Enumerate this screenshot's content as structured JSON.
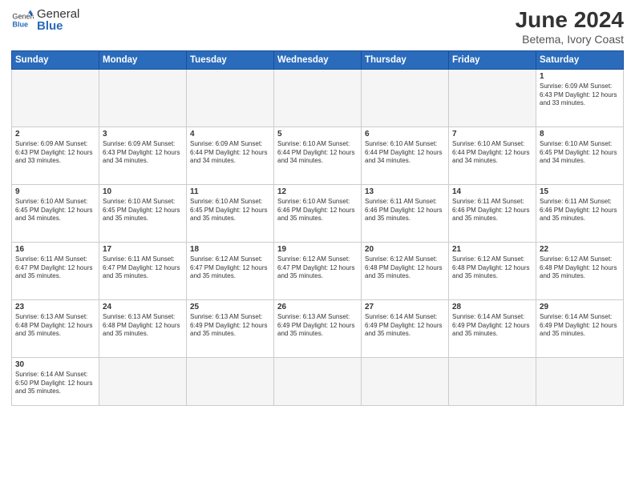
{
  "header": {
    "logo_general": "General",
    "logo_blue": "Blue",
    "title": "June 2024",
    "subtitle": "Betema, Ivory Coast"
  },
  "weekdays": [
    "Sunday",
    "Monday",
    "Tuesday",
    "Wednesday",
    "Thursday",
    "Friday",
    "Saturday"
  ],
  "weeks": [
    [
      {
        "day": "",
        "info": ""
      },
      {
        "day": "",
        "info": ""
      },
      {
        "day": "",
        "info": ""
      },
      {
        "day": "",
        "info": ""
      },
      {
        "day": "",
        "info": ""
      },
      {
        "day": "",
        "info": ""
      },
      {
        "day": "1",
        "info": "Sunrise: 6:09 AM\nSunset: 6:43 PM\nDaylight: 12 hours and 33 minutes."
      }
    ],
    [
      {
        "day": "2",
        "info": "Sunrise: 6:09 AM\nSunset: 6:43 PM\nDaylight: 12 hours and 33 minutes."
      },
      {
        "day": "3",
        "info": "Sunrise: 6:09 AM\nSunset: 6:43 PM\nDaylight: 12 hours and 34 minutes."
      },
      {
        "day": "4",
        "info": "Sunrise: 6:09 AM\nSunset: 6:44 PM\nDaylight: 12 hours and 34 minutes."
      },
      {
        "day": "5",
        "info": "Sunrise: 6:10 AM\nSunset: 6:44 PM\nDaylight: 12 hours and 34 minutes."
      },
      {
        "day": "6",
        "info": "Sunrise: 6:10 AM\nSunset: 6:44 PM\nDaylight: 12 hours and 34 minutes."
      },
      {
        "day": "7",
        "info": "Sunrise: 6:10 AM\nSunset: 6:44 PM\nDaylight: 12 hours and 34 minutes."
      },
      {
        "day": "8",
        "info": "Sunrise: 6:10 AM\nSunset: 6:45 PM\nDaylight: 12 hours and 34 minutes."
      }
    ],
    [
      {
        "day": "9",
        "info": "Sunrise: 6:10 AM\nSunset: 6:45 PM\nDaylight: 12 hours and 34 minutes."
      },
      {
        "day": "10",
        "info": "Sunrise: 6:10 AM\nSunset: 6:45 PM\nDaylight: 12 hours and 35 minutes."
      },
      {
        "day": "11",
        "info": "Sunrise: 6:10 AM\nSunset: 6:45 PM\nDaylight: 12 hours and 35 minutes."
      },
      {
        "day": "12",
        "info": "Sunrise: 6:10 AM\nSunset: 6:46 PM\nDaylight: 12 hours and 35 minutes."
      },
      {
        "day": "13",
        "info": "Sunrise: 6:11 AM\nSunset: 6:46 PM\nDaylight: 12 hours and 35 minutes."
      },
      {
        "day": "14",
        "info": "Sunrise: 6:11 AM\nSunset: 6:46 PM\nDaylight: 12 hours and 35 minutes."
      },
      {
        "day": "15",
        "info": "Sunrise: 6:11 AM\nSunset: 6:46 PM\nDaylight: 12 hours and 35 minutes."
      }
    ],
    [
      {
        "day": "16",
        "info": "Sunrise: 6:11 AM\nSunset: 6:47 PM\nDaylight: 12 hours and 35 minutes."
      },
      {
        "day": "17",
        "info": "Sunrise: 6:11 AM\nSunset: 6:47 PM\nDaylight: 12 hours and 35 minutes."
      },
      {
        "day": "18",
        "info": "Sunrise: 6:12 AM\nSunset: 6:47 PM\nDaylight: 12 hours and 35 minutes."
      },
      {
        "day": "19",
        "info": "Sunrise: 6:12 AM\nSunset: 6:47 PM\nDaylight: 12 hours and 35 minutes."
      },
      {
        "day": "20",
        "info": "Sunrise: 6:12 AM\nSunset: 6:48 PM\nDaylight: 12 hours and 35 minutes."
      },
      {
        "day": "21",
        "info": "Sunrise: 6:12 AM\nSunset: 6:48 PM\nDaylight: 12 hours and 35 minutes."
      },
      {
        "day": "22",
        "info": "Sunrise: 6:12 AM\nSunset: 6:48 PM\nDaylight: 12 hours and 35 minutes."
      }
    ],
    [
      {
        "day": "23",
        "info": "Sunrise: 6:13 AM\nSunset: 6:48 PM\nDaylight: 12 hours and 35 minutes."
      },
      {
        "day": "24",
        "info": "Sunrise: 6:13 AM\nSunset: 6:48 PM\nDaylight: 12 hours and 35 minutes."
      },
      {
        "day": "25",
        "info": "Sunrise: 6:13 AM\nSunset: 6:49 PM\nDaylight: 12 hours and 35 minutes."
      },
      {
        "day": "26",
        "info": "Sunrise: 6:13 AM\nSunset: 6:49 PM\nDaylight: 12 hours and 35 minutes."
      },
      {
        "day": "27",
        "info": "Sunrise: 6:14 AM\nSunset: 6:49 PM\nDaylight: 12 hours and 35 minutes."
      },
      {
        "day": "28",
        "info": "Sunrise: 6:14 AM\nSunset: 6:49 PM\nDaylight: 12 hours and 35 minutes."
      },
      {
        "day": "29",
        "info": "Sunrise: 6:14 AM\nSunset: 6:49 PM\nDaylight: 12 hours and 35 minutes."
      }
    ],
    [
      {
        "day": "30",
        "info": "Sunrise: 6:14 AM\nSunset: 6:50 PM\nDaylight: 12 hours and 35 minutes."
      },
      {
        "day": "",
        "info": ""
      },
      {
        "day": "",
        "info": ""
      },
      {
        "day": "",
        "info": ""
      },
      {
        "day": "",
        "info": ""
      },
      {
        "day": "",
        "info": ""
      },
      {
        "day": "",
        "info": ""
      }
    ]
  ]
}
